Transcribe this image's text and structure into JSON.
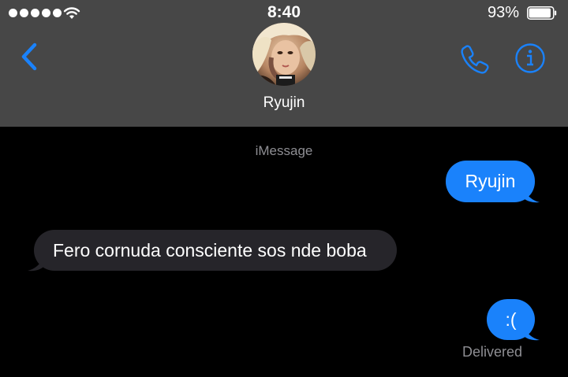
{
  "status_bar": {
    "time": "8:40",
    "battery_percent": "93%",
    "battery_level": 0.93,
    "signal_bars": 5
  },
  "header": {
    "contact_name": "Ryujin",
    "back_icon": "chevron-left-icon",
    "call_icon": "phone-icon",
    "info_icon": "info-icon"
  },
  "conversation": {
    "service_label": "iMessage",
    "messages": [
      {
        "direction": "outgoing",
        "text": "Ryujin"
      },
      {
        "direction": "incoming",
        "text": "Fero cornuda consciente sos nde boba"
      },
      {
        "direction": "outgoing",
        "text": ":("
      }
    ],
    "receipt": "Delivered"
  },
  "colors": {
    "header_background": "#474747",
    "background": "#000000",
    "accent": "#1a82fb",
    "incoming_bubble": "#26252a",
    "secondary_text": "#8e8e93"
  }
}
